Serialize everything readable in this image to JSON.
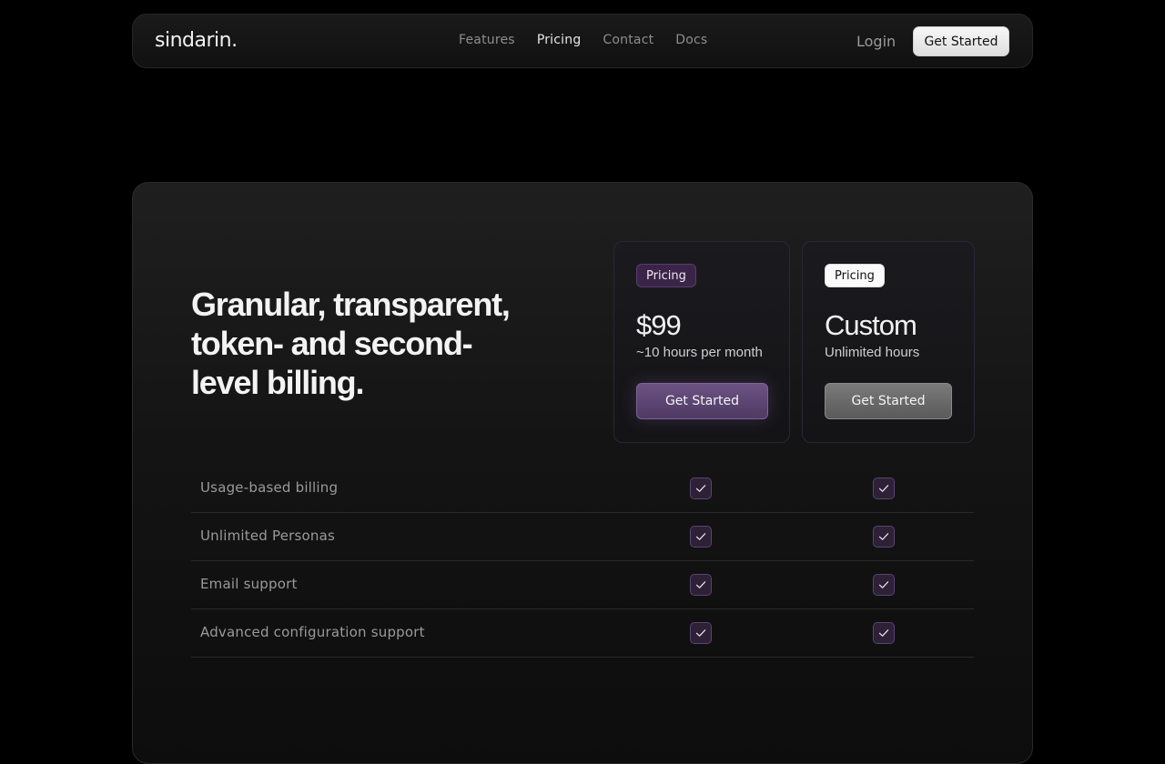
{
  "nav": {
    "logo": "sindarin.",
    "links": [
      "Features",
      "Pricing",
      "Contact",
      "Docs"
    ],
    "active_link": "Pricing",
    "login": "Login",
    "cta": "Get Started"
  },
  "pricing": {
    "headline": "Granular, transparent, token- and second-level billing.",
    "plans": [
      {
        "badge": "Pricing",
        "price": "$99",
        "hours": "~10 hours per month",
        "cta": "Get Started"
      },
      {
        "badge": "Pricing",
        "price": "Custom",
        "hours": "Unlimited hours",
        "cta": "Get Started"
      }
    ],
    "features": [
      {
        "label": "Usage-based billing",
        "plan_a": true,
        "plan_b": true
      },
      {
        "label": "Unlimited Personas",
        "plan_a": true,
        "plan_b": true
      },
      {
        "label": "Email support",
        "plan_a": true,
        "plan_b": true
      },
      {
        "label": "Advanced configuration support",
        "plan_a": true,
        "plan_b": true
      }
    ]
  },
  "colors": {
    "accent_purple": "#6c5283",
    "check_bg": "#2e2036",
    "background": "#000000"
  }
}
